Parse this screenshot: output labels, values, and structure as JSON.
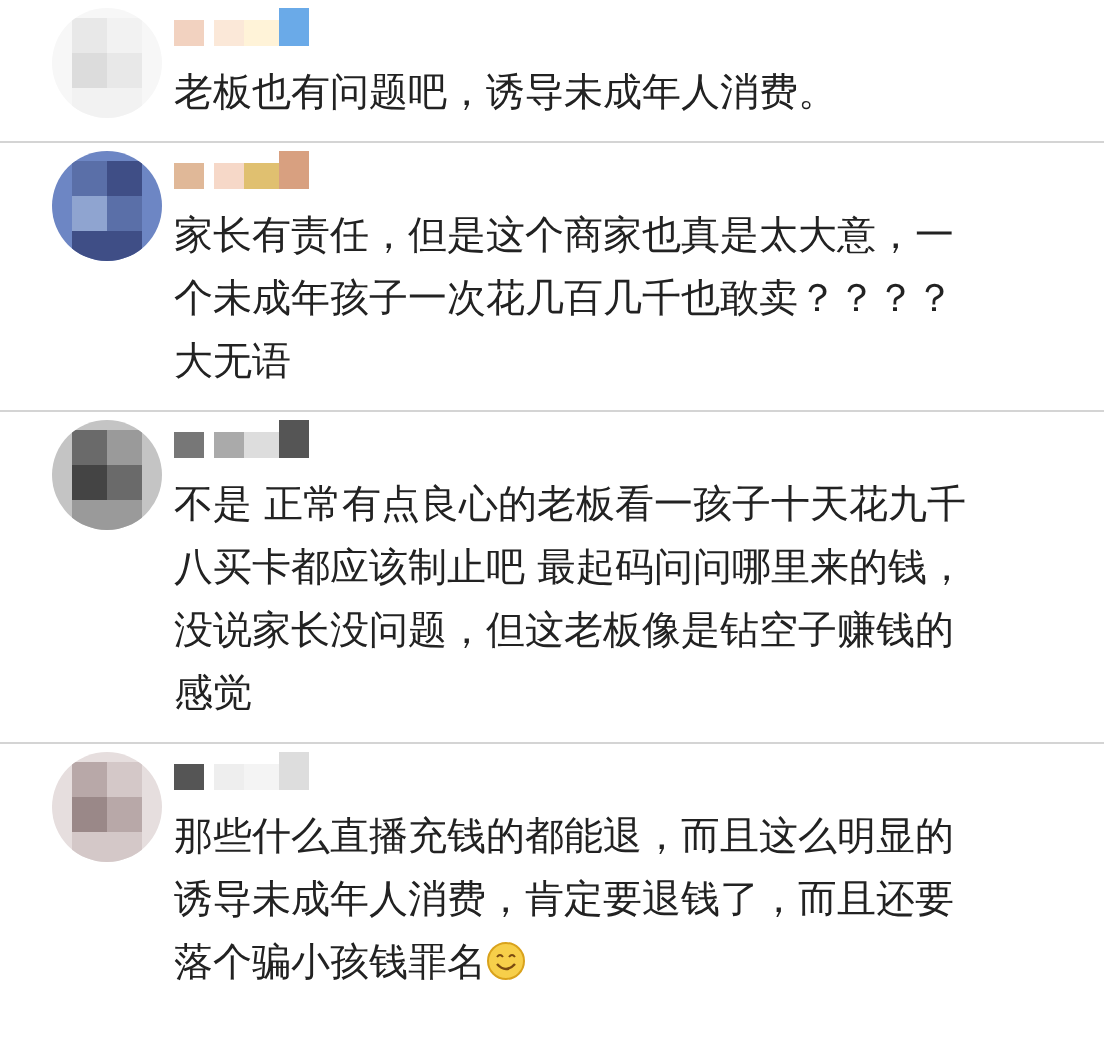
{
  "comments": [
    {
      "lines": [
        "老板也有问题吧，诱导未成年人消费。"
      ],
      "trailing_emoji": false
    },
    {
      "lines": [
        "家长有责任，但是这个商家也真是太大意，一",
        "个未成年孩子一次花几百几千也敢卖？？？？",
        "大无语"
      ],
      "trailing_emoji": false
    },
    {
      "lines": [
        "不是 正常有点良心的老板看一孩子十天花九千",
        "八买卡都应该制止吧 最起码问问哪里来的钱，",
        "没说家长没问题，但这老板像是钻空子赚钱的",
        "感觉"
      ],
      "trailing_emoji": false
    },
    {
      "lines": [
        "那些什么直播充钱的都能退，而且这么明显的",
        "诱导未成年人消费，肯定要退钱了，而且还要",
        "落个骗小孩钱罪名"
      ],
      "trailing_emoji": true
    }
  ]
}
